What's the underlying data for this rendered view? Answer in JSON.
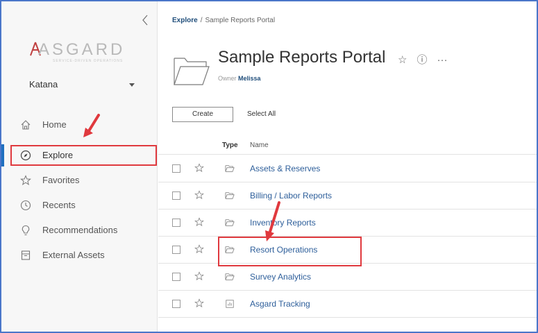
{
  "sidebar": {
    "logo_text": "ASGARD",
    "logo_subtext": "SERVICE-DRIVEN OPERATIONS",
    "site": "Katana",
    "items": [
      {
        "label": "Home",
        "icon": "home-icon"
      },
      {
        "label": "Explore",
        "icon": "compass-icon"
      },
      {
        "label": "Favorites",
        "icon": "star-icon"
      },
      {
        "label": "Recents",
        "icon": "clock-icon"
      },
      {
        "label": "Recommendations",
        "icon": "lightbulb-icon"
      },
      {
        "label": "External Assets",
        "icon": "archive-icon"
      }
    ]
  },
  "breadcrumb": {
    "root": "Explore",
    "separator": "/",
    "current": "Sample Reports Portal"
  },
  "header": {
    "title": "Sample Reports Portal",
    "owner_label": "Owner",
    "owner_name": "Melissa",
    "star_glyph": "☆",
    "info_glyph": "ⓘ",
    "more_glyph": "···"
  },
  "toolbar": {
    "create_label": "Create",
    "select_all_label": "Select All"
  },
  "table": {
    "columns": {
      "type": "Type",
      "name": "Name"
    },
    "rows": [
      {
        "name": "Assets & Reserves",
        "type": "folder"
      },
      {
        "name": "Billing / Labor Reports",
        "type": "folder"
      },
      {
        "name": "Inventory Reports",
        "type": "folder"
      },
      {
        "name": "Resort Operations",
        "type": "folder"
      },
      {
        "name": "Survey Analytics",
        "type": "folder"
      },
      {
        "name": "Asgard Tracking",
        "type": "workbook"
      }
    ]
  },
  "colors": {
    "accent": "#1f6fbf",
    "link": "#2d5e9a",
    "highlight": "#e0393e",
    "frame": "#4a76c9"
  }
}
